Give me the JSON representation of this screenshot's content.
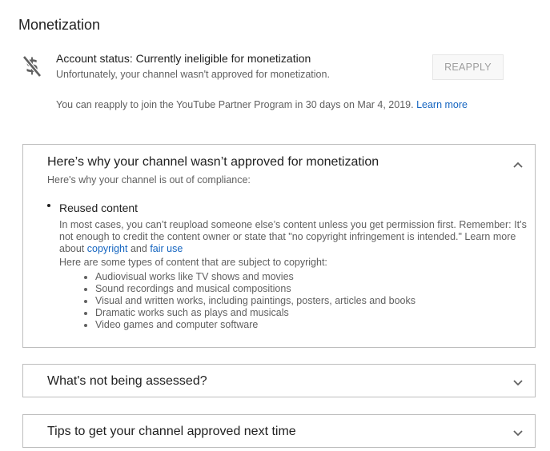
{
  "page": {
    "title": "Monetization"
  },
  "status": {
    "icon": "no-money-icon",
    "main": "Account status: Currently ineligible for monetization",
    "sub": "Unfortunately, your channel wasn't approved for monetization.",
    "reapply_label": "REAPPLY",
    "note": "You can reapply to join the YouTube Partner Program in 30 days on Mar 4, 2019.",
    "learn_more": "Learn more"
  },
  "panels": {
    "why": {
      "title": "Here’s why your channel wasn’t approved for monetization",
      "subtitle": "Here's why your channel is out of compliance:",
      "reason_title": "Reused content",
      "reason_desc": "In most cases, you can’t reupload someone else’s content unless you get permission first. Remember: It’s not enough to credit the content owner or state that \"no copyright infringement is intended.\" Learn more about",
      "copyright_link": "copyright",
      "and": "and",
      "fair_use_link": "fair use",
      "types_intro": "Here are some types of content that are subject to copyright:",
      "types": [
        "Audiovisual works like TV shows and movies",
        "Sound recordings and musical compositions",
        "Visual and written works, including paintings, posters, articles and books",
        "Dramatic works such as plays and musicals",
        "Video games and computer software"
      ]
    },
    "not_assessed": {
      "title": "What's not being assessed?"
    },
    "tips": {
      "title": "Tips to get your channel approved next time"
    }
  },
  "colors": {
    "link": "#1565c0",
    "border": "#bdbdbd",
    "muted_text": "#606060"
  }
}
